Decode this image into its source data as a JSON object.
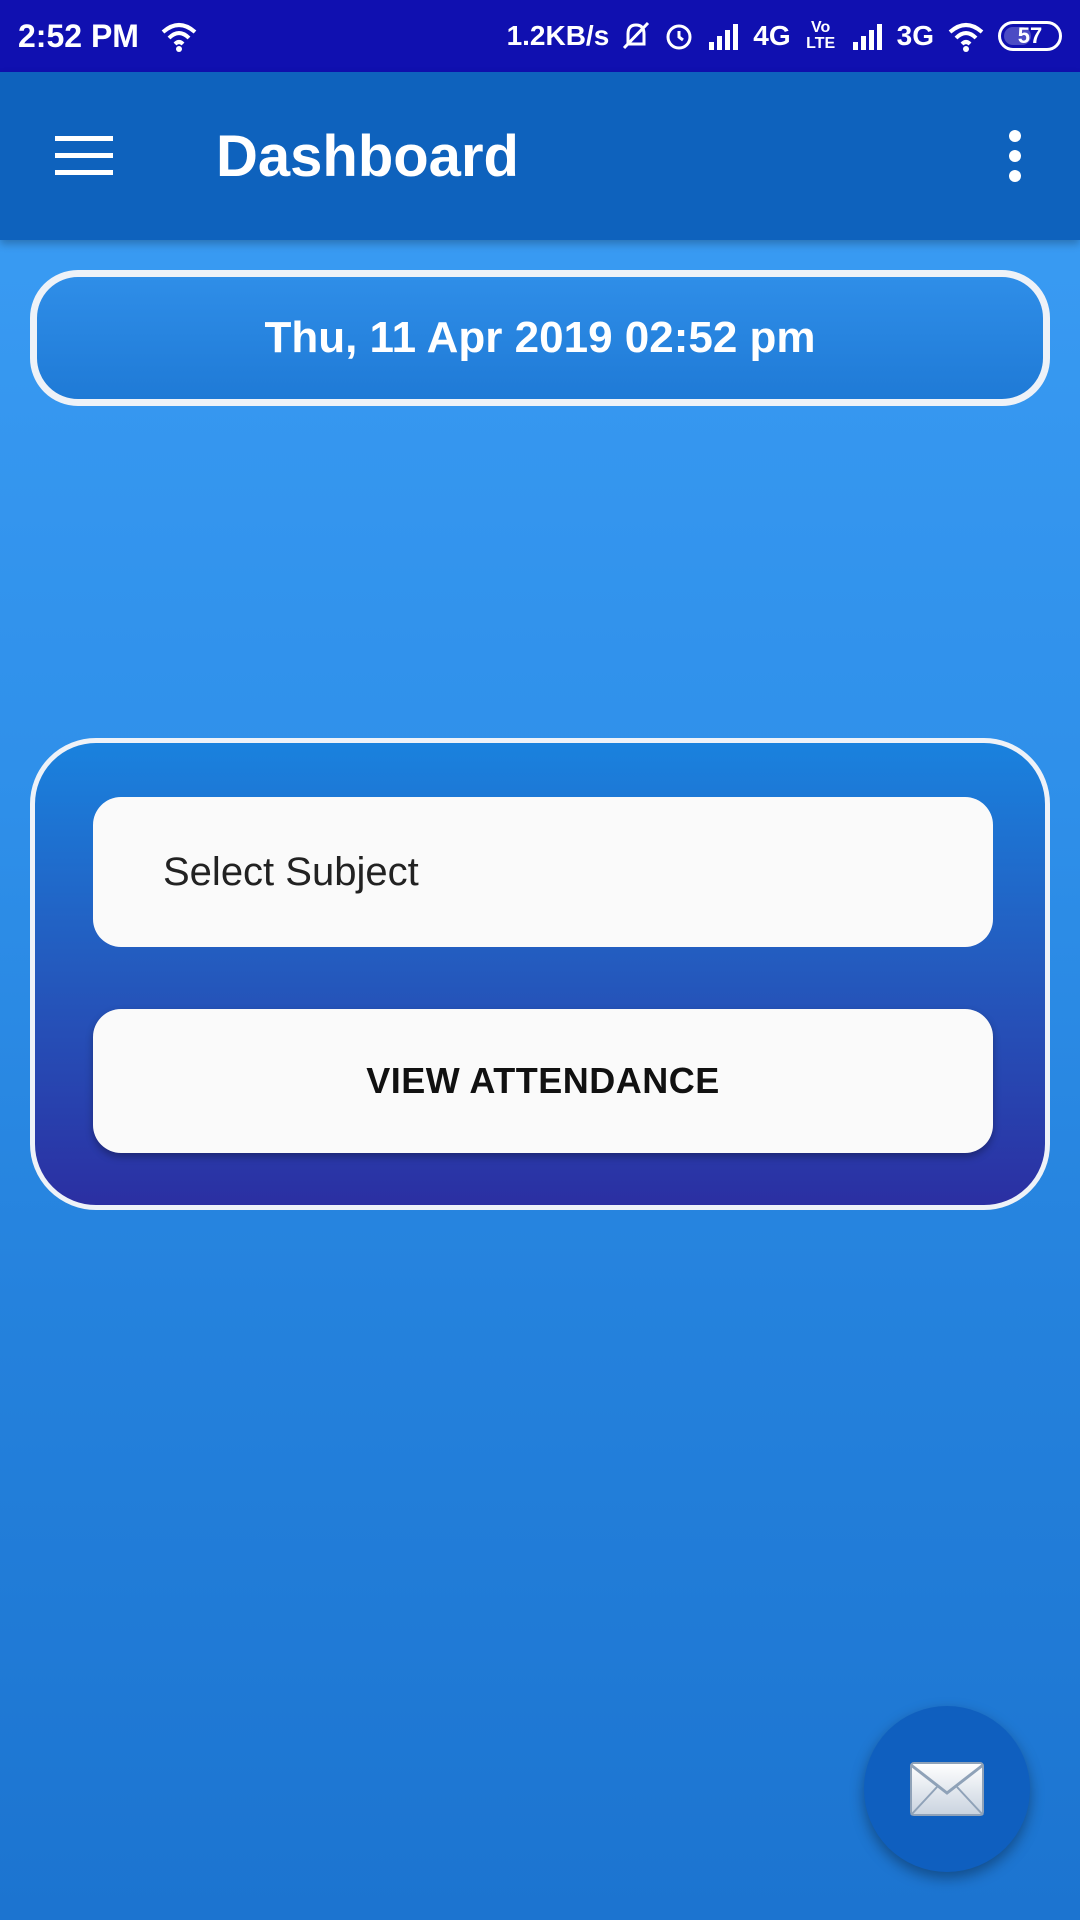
{
  "status_bar": {
    "time": "2:52 PM",
    "net_speed": "1.2KB/s",
    "network_1": "4G",
    "volte": "Vo LTE",
    "network_2": "3G",
    "battery": "57",
    "battery_level": 0.57
  },
  "app_bar": {
    "title": "Dashboard"
  },
  "date_pill": {
    "text": "Thu, 11 Apr 2019 02:52 pm"
  },
  "card": {
    "select_label": "Select Subject",
    "view_button": "VIEW ATTENDANCE"
  },
  "fab": {
    "icon": "mail-icon"
  },
  "colors": {
    "status_bar": "#1010b0",
    "app_bar": "#0e62bd",
    "background": "#3d9ff6",
    "card_top": "#1a82de",
    "card_bottom": "#2b2fa2",
    "fab": "#0f5fbf"
  }
}
